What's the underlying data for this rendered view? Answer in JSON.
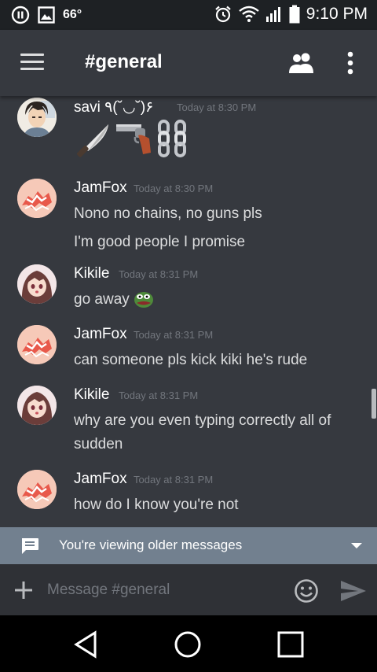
{
  "status_bar": {
    "temperature": "66°",
    "time": "9:10 PM"
  },
  "header": {
    "channel": "#general"
  },
  "messages": [
    {
      "author": "savi ٩(˘◡˘)۶",
      "timestamp": "Today at 8:30 PM",
      "avatar": "anime-boy-avatar",
      "lines": [],
      "emojis": [
        "knife-emoji",
        "gun-emoji",
        "chains-emoji"
      ]
    },
    {
      "author": "JamFox",
      "timestamp": "Today at 8:30 PM",
      "avatar": "red-fox-avatar",
      "lines": [
        "Nono no chains, no guns pls",
        "I'm good people I promise"
      ]
    },
    {
      "author": "Kikile",
      "timestamp": "Today at 8:31 PM",
      "avatar": "anime-girl-avatar",
      "lines": [
        "go away"
      ],
      "emojis": [
        "pepe-emoji"
      ]
    },
    {
      "author": "JamFox",
      "timestamp": "Today at 8:31 PM",
      "avatar": "red-fox-avatar",
      "lines": [
        "can someone pls kick kiki he's rude"
      ]
    },
    {
      "author": "Kikile",
      "timestamp": "Today at 8:31 PM",
      "avatar": "anime-girl-avatar",
      "lines": [
        "why are you even typing correctly all of",
        "sudden"
      ]
    },
    {
      "author": "JamFox",
      "timestamp": "Today at 8:31 PM",
      "avatar": "red-fox-avatar",
      "lines": [
        "how do I know you're not"
      ]
    }
  ],
  "older_bar": {
    "text": "You're viewing older messages"
  },
  "composer": {
    "placeholder": "Message #general"
  },
  "colors": {
    "background": "#36393f",
    "composer": "#2f3136",
    "older_bar": "#72808f",
    "muted": "#72767d"
  }
}
